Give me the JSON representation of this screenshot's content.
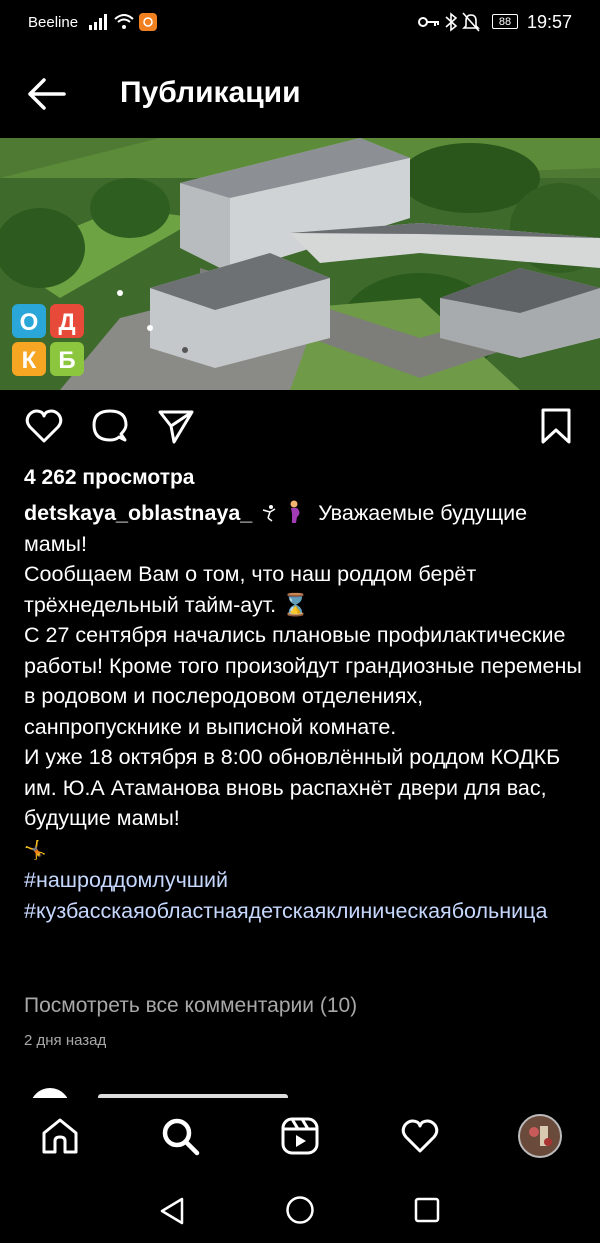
{
  "status_bar": {
    "carrier": "Beeline",
    "battery": "88",
    "time": "19:57"
  },
  "header": {
    "title": "Публикации"
  },
  "photo": {
    "logo_letters": [
      "О",
      "Д",
      "К",
      "Б"
    ]
  },
  "post": {
    "views": "4 262 просмотра",
    "username": "detskaya_oblastnaya_",
    "caption_lines": [
      "Уважаемые будущие мамы!",
      "Сообщаем Вам о том, что наш роддом берёт трёхнедельный тайм-аут. ⌛",
      "С 27 сентября начались  плановые профилактические работы! Кроме того произойдут грандиозные перемены в родовом и послеродовом отделениях, санпропускнике и выписной комнате.",
      "И уже 18 октября в 8:00 обновлённый роддом КОДКБ им. Ю.А Атаманова вновь распахнёт двери для вас, будущие мамы!",
      "🤸"
    ],
    "hashtags": [
      "#нашроддомлучший",
      "#кузбасскаяобластнаядетскаяклиническаябольница"
    ],
    "view_comments": "Посмотреть все комментарии (10)",
    "posted": "2 дня назад"
  },
  "icons": {
    "actions": [
      "heart-icon",
      "comment-icon",
      "share-icon",
      "bookmark-icon"
    ],
    "nav": [
      "home-icon",
      "search-icon",
      "reels-icon",
      "activity-heart-icon",
      "profile-avatar"
    ],
    "system": [
      "back-triangle-icon",
      "home-circle-icon",
      "recents-square-icon"
    ]
  }
}
